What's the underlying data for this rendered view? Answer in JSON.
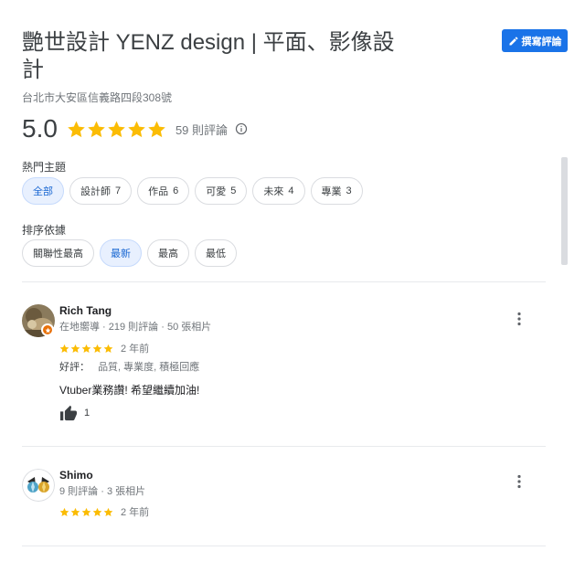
{
  "place": {
    "title": "艷世設計 YENZ design | 平面、影像設計",
    "address": "台北市大安區信義路四段308號"
  },
  "write_review": {
    "label": "撰寫評論",
    "icon": "pencil-icon"
  },
  "rating": {
    "score": "5.0",
    "stars": 5,
    "count_label": "59 則評論",
    "info_icon": "info-icon"
  },
  "topics": {
    "label": "熱門主題",
    "chips": [
      {
        "label": "全部",
        "count": "",
        "selected": true
      },
      {
        "label": "設計師",
        "count": "7",
        "selected": false
      },
      {
        "label": "作品",
        "count": "6",
        "selected": false
      },
      {
        "label": "可愛",
        "count": "5",
        "selected": false
      },
      {
        "label": "未來",
        "count": "4",
        "selected": false
      },
      {
        "label": "專業",
        "count": "3",
        "selected": false
      }
    ]
  },
  "sort": {
    "label": "排序依據",
    "options": [
      {
        "label": "關聯性最高",
        "selected": false
      },
      {
        "label": "最新",
        "selected": true
      },
      {
        "label": "最高",
        "selected": false
      },
      {
        "label": "最低",
        "selected": false
      }
    ]
  },
  "reviews": [
    {
      "name": "Rich Tang",
      "meta": "在地嚮導 · 219 則評論 · 50 張相片",
      "stars": 5,
      "time": "2 年前",
      "highlights_label": "好評：",
      "highlights": "品質, 專業度, 積極回應",
      "text": "Vtuber業務讚! 希望繼續加油!",
      "likes": "1",
      "local_guide": true
    },
    {
      "name": "Shimo",
      "meta": "9 則評論 · 3 張相片",
      "stars": 5,
      "time": "2 年前",
      "local_guide": false
    }
  ],
  "colors": {
    "star": "#fbbc04",
    "accent": "#1a73e8",
    "selected_chip_bg": "#e8f0fe",
    "badge": "#e8710a"
  }
}
